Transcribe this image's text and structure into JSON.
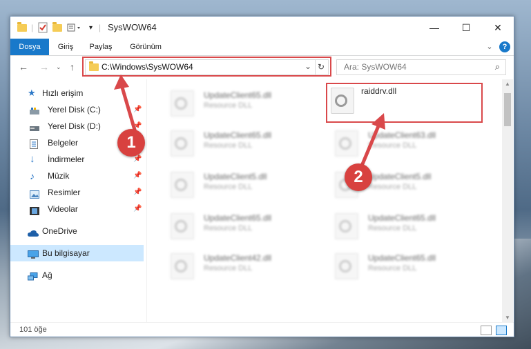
{
  "window": {
    "title": "SysWOW64",
    "minimize": "—",
    "maximize": "☐",
    "close": "✕"
  },
  "ribbon": {
    "tabs": [
      {
        "label": "Dosya"
      },
      {
        "label": "Giriş"
      },
      {
        "label": "Paylaş"
      },
      {
        "label": "Görünüm"
      }
    ],
    "expand": "⌄",
    "help": "?"
  },
  "address": {
    "path": "C:\\Windows\\SysWOW64",
    "search_placeholder": "Ara: SysWOW64"
  },
  "nav": {
    "quick_access": "Hızlı erişim",
    "items": [
      {
        "label": "Yerel Disk (C:)"
      },
      {
        "label": "Yerel Disk (D:)"
      },
      {
        "label": "Belgeler"
      },
      {
        "label": "İndirmeler"
      },
      {
        "label": "Müzik"
      },
      {
        "label": "Resimler"
      },
      {
        "label": "Videolar"
      }
    ],
    "onedrive": "OneDrive",
    "this_pc": "Bu bilgisayar",
    "network": "Ağ"
  },
  "files": {
    "left": [
      {
        "name": "UpdateClient65.dll",
        "type": "Resource DLL"
      },
      {
        "name": "UpdateClient65.dll",
        "type": "Resource DLL"
      },
      {
        "name": "UpdateClient5.dll",
        "type": "Resource DLL"
      },
      {
        "name": "UpdateClient65.dll",
        "type": "Resource DLL"
      },
      {
        "name": "UpdateClient42.dll",
        "type": "Resource DLL"
      }
    ],
    "highlighted": {
      "name": "raiddrv.dll"
    },
    "right": [
      {
        "name": "UpdateClient63.dll",
        "type": "Resource DLL"
      },
      {
        "name": "UpdateClient5.dll",
        "type": "Resource DLL"
      },
      {
        "name": "UpdateClient65.dll",
        "type": "Resource DLL"
      },
      {
        "name": "UpdateClient65.dll",
        "type": "Resource DLL"
      }
    ]
  },
  "status": {
    "count": "101 öğe"
  },
  "annotations": {
    "step1": "1",
    "step2": "2",
    "color": "#d9484a"
  }
}
